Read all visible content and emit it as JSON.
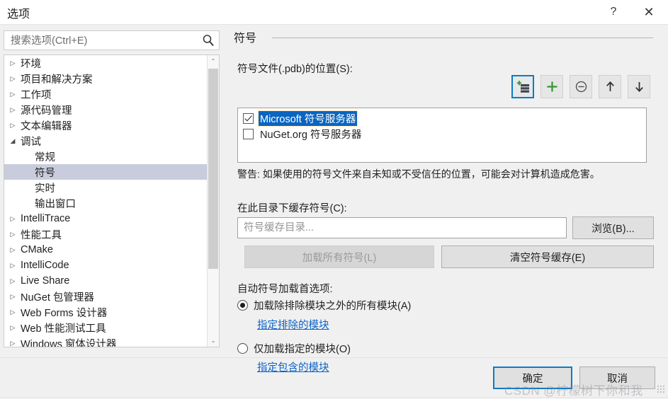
{
  "window": {
    "title": "选项",
    "help_label": "?",
    "close_label": "✕"
  },
  "search": {
    "placeholder": "搜索选项(Ctrl+E)",
    "value": "",
    "icon": "search-icon"
  },
  "tree": {
    "items": [
      {
        "label": "环境",
        "leaf": false,
        "expanded": false,
        "selected": false
      },
      {
        "label": "项目和解决方案",
        "leaf": false,
        "expanded": false,
        "selected": false
      },
      {
        "label": "工作项",
        "leaf": false,
        "expanded": false,
        "selected": false
      },
      {
        "label": "源代码管理",
        "leaf": false,
        "expanded": false,
        "selected": false
      },
      {
        "label": "文本编辑器",
        "leaf": false,
        "expanded": false,
        "selected": false
      },
      {
        "label": "调试",
        "leaf": false,
        "expanded": true,
        "selected": false
      },
      {
        "label": "常规",
        "leaf": true,
        "expanded": false,
        "selected": false
      },
      {
        "label": "符号",
        "leaf": true,
        "expanded": false,
        "selected": true
      },
      {
        "label": "实时",
        "leaf": true,
        "expanded": false,
        "selected": false
      },
      {
        "label": "输出窗口",
        "leaf": true,
        "expanded": false,
        "selected": false
      },
      {
        "label": "IntelliTrace",
        "leaf": false,
        "expanded": false,
        "selected": false
      },
      {
        "label": "性能工具",
        "leaf": false,
        "expanded": false,
        "selected": false
      },
      {
        "label": "CMake",
        "leaf": false,
        "expanded": false,
        "selected": false
      },
      {
        "label": "IntelliCode",
        "leaf": false,
        "expanded": false,
        "selected": false
      },
      {
        "label": "Live Share",
        "leaf": false,
        "expanded": false,
        "selected": false
      },
      {
        "label": "NuGet 包管理器",
        "leaf": false,
        "expanded": false,
        "selected": false
      },
      {
        "label": "Web Forms 设计器",
        "leaf": false,
        "expanded": false,
        "selected": false
      },
      {
        "label": "Web 性能测试工具",
        "leaf": false,
        "expanded": false,
        "selected": false
      },
      {
        "label": "Windows 窗体设计器",
        "leaf": false,
        "expanded": false,
        "selected": false
      }
    ],
    "collapsed_glyph": "▷",
    "expanded_glyph": "◢",
    "scrollbar": {
      "up_glyph": "⌃",
      "down_glyph": "⌄"
    }
  },
  "pane": {
    "title": "符号",
    "pdb_label": "符号文件(.pdb)的位置(S):",
    "toolbar": [
      {
        "name": "new-symbol-server-location-button",
        "focused": true
      },
      {
        "name": "add-location-button",
        "focused": false
      },
      {
        "name": "remove-location-button",
        "focused": false
      },
      {
        "name": "move-up-button",
        "focused": false
      },
      {
        "name": "move-down-button",
        "focused": false
      }
    ],
    "symbol_locations": [
      {
        "label": "Microsoft 符号服务器",
        "checked": true,
        "selected": true
      },
      {
        "label": "NuGet.org 符号服务器",
        "checked": false,
        "selected": false
      }
    ],
    "warning": "警告: 如果使用的符号文件来自未知或不受信任的位置，可能会对计算机造成危害。",
    "cache_label": "在此目录下缓存符号(C):",
    "cache_placeholder": "符号缓存目录...",
    "cache_value": "",
    "browse_label": "浏览(B)...",
    "load_all_label": "加载所有符号(L)",
    "load_all_enabled": false,
    "clear_cache_label": "清空符号缓存(E)",
    "autoload_label": "自动符号加载首选项:",
    "radios": [
      {
        "label": "加载除排除模块之外的所有模块(A)",
        "selected": true,
        "link": "指定排除的模块"
      },
      {
        "label": "仅加载指定的模块(O)",
        "selected": false,
        "link": "指定包含的模块"
      }
    ]
  },
  "footer": {
    "ok_label": "确定",
    "cancel_label": "取消"
  },
  "watermark": "CSDN @柠檬树下你和我",
  "colors": {
    "accent": "#0d7ac4",
    "selection": "#0a65c1",
    "tree_selection": "#c9ccdc",
    "link": "#0c63c7",
    "dialog_bg": "#f0f0f0",
    "add_icon_green": "#3a9b35"
  }
}
